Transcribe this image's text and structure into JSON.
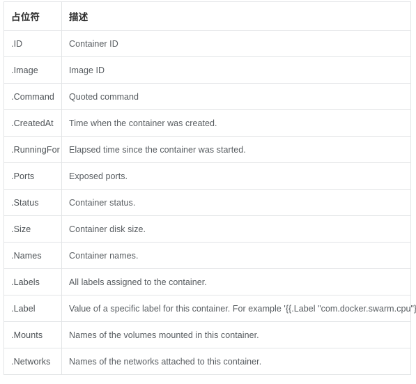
{
  "table": {
    "columns": [
      {
        "key": "placeholder",
        "label": "占位符"
      },
      {
        "key": "description",
        "label": "描述"
      }
    ],
    "rows": [
      {
        "placeholder": ".ID",
        "description": "Container ID"
      },
      {
        "placeholder": ".Image",
        "description": "Image ID"
      },
      {
        "placeholder": ".Command",
        "description": "Quoted command"
      },
      {
        "placeholder": ".CreatedAt",
        "description": "Time when the container was created."
      },
      {
        "placeholder": ".RunningFor",
        "description": "Elapsed time since the container was started."
      },
      {
        "placeholder": ".Ports",
        "description": "Exposed ports."
      },
      {
        "placeholder": ".Status",
        "description": "Container status."
      },
      {
        "placeholder": ".Size",
        "description": "Container disk size."
      },
      {
        "placeholder": ".Names",
        "description": "Container names."
      },
      {
        "placeholder": ".Labels",
        "description": "All labels assigned to the container."
      },
      {
        "placeholder": ".Label",
        "description": "Value of a specific label for this container. For example '{{.Label \"com.docker.swarm.cpu\"}}'"
      },
      {
        "placeholder": ".Mounts",
        "description": "Names of the volumes mounted in this container."
      },
      {
        "placeholder": ".Networks",
        "description": "Names of the networks attached to this container."
      }
    ]
  },
  "colors": {
    "border": "#e2e4e6",
    "header_text": "#2f2f2f",
    "body_text": "#575c60",
    "background": "#ffffff"
  }
}
